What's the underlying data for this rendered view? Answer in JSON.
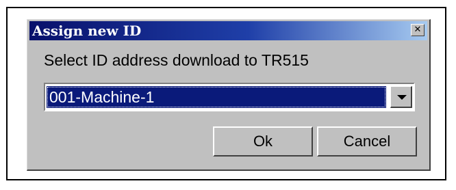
{
  "dialog": {
    "title": "Assign new ID",
    "close_glyph": "✕",
    "prompt": "Select ID address download to TR515",
    "id_select": {
      "value": "001-Machine-1"
    },
    "ok_label": "Ok",
    "cancel_label": "Cancel"
  },
  "icons": {
    "close": "close-icon",
    "dropdown": "chevron-down-icon"
  },
  "colors": {
    "titlebar_start": "#08106b",
    "titlebar_end": "#a6caf0",
    "face": "#c0c0c0",
    "selection": "#0a1a7a"
  }
}
